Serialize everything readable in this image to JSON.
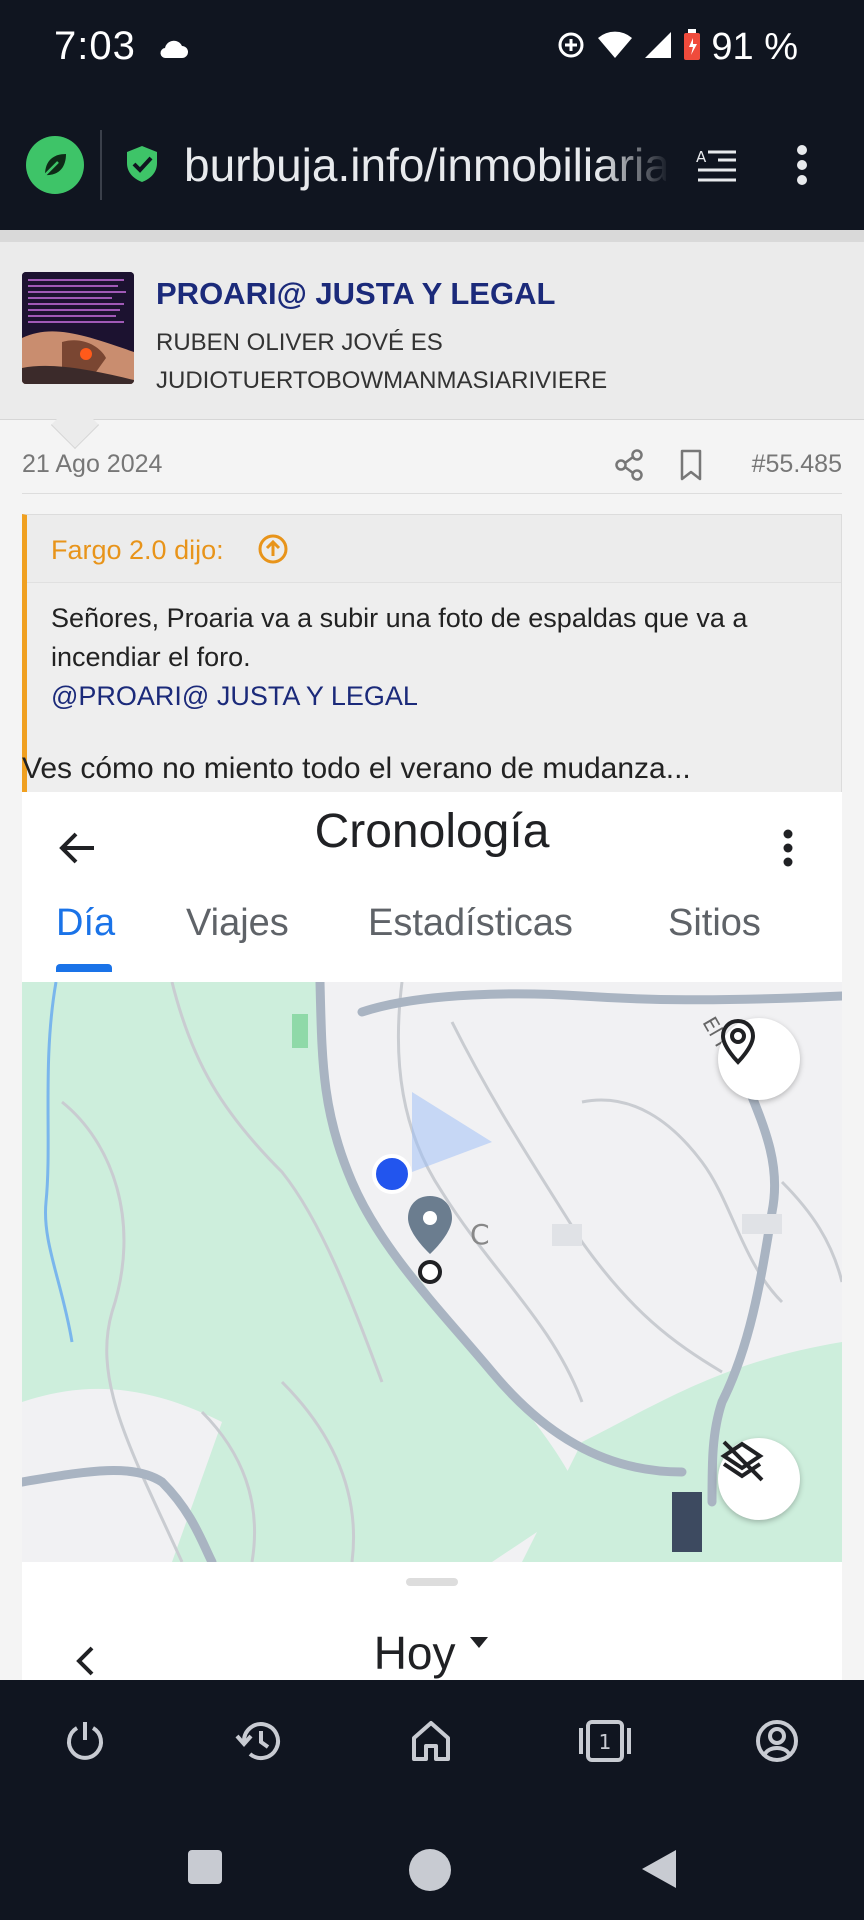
{
  "status_bar": {
    "time": "7:03",
    "battery": "91 %"
  },
  "browser": {
    "url": "burbuja.info/inmobiliaria"
  },
  "post": {
    "author": "PROARI@ JUSTA Y LEGAL",
    "user_title_line1": "RUBEN OLIVER JOVÉ ES",
    "user_title_line2": "JUDIOTUERTOBOWMANMASIARIVIERE",
    "date": "21 Ago 2024",
    "post_number": "#55.485",
    "quote": {
      "author": "Fargo 2.0 dijo:",
      "body": "Señores, Proaria va a subir una foto de espaldas que va a incendiar el foro.",
      "mention": "@PROARI@ JUSTA Y LEGAL"
    },
    "text": "Ves cómo no miento todo el verano de mudanza..."
  },
  "embedded_screenshot": {
    "title": "Cronología",
    "tabs": [
      "Día",
      "Viajes",
      "Estadísticas",
      "Sitios"
    ],
    "map_label": "C",
    "map_road_label": "El P",
    "day_selector": "Hoy"
  }
}
